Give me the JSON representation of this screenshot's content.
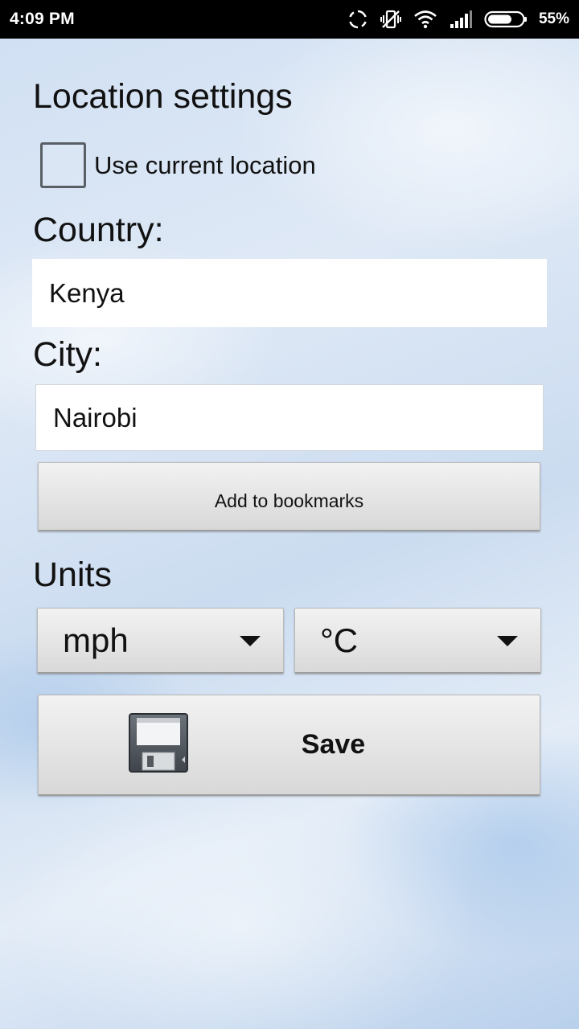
{
  "status_bar": {
    "time": "4:09 PM",
    "battery": "55%",
    "icons": [
      "sync-icon",
      "vibrate-off-icon",
      "wifi-icon",
      "signal-icon",
      "battery-icon"
    ]
  },
  "location": {
    "title": "Location settings",
    "use_current_label": "Use current location",
    "use_current_checked": false
  },
  "country": {
    "label": "Country:",
    "value": "Kenya"
  },
  "city": {
    "label": "City:",
    "value": "Nairobi"
  },
  "bookmarks_button": "Add to bookmarks",
  "units": {
    "title": "Units",
    "speed_selected": "mph",
    "temperature_selected": "°C"
  },
  "save": {
    "label": "Save",
    "icon": "floppy-disk-icon"
  }
}
